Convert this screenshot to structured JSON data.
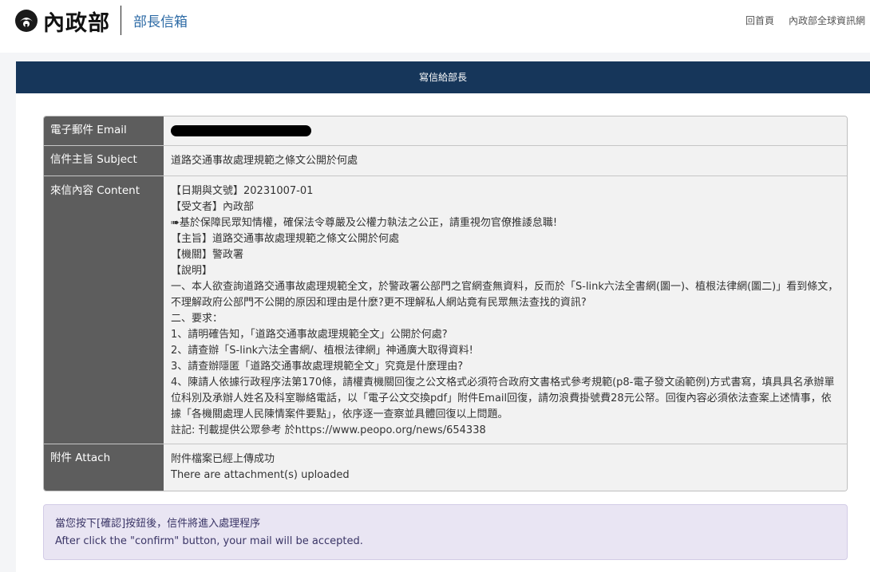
{
  "header": {
    "logo_text": "內政部",
    "site_title": "部長信箱",
    "nav": [
      "回首頁",
      "內政部全球資訊網"
    ]
  },
  "card": {
    "title": "寫信給部長"
  },
  "form": {
    "email_label": "電子郵件 Email",
    "subject_label": "信件主旨 Subject",
    "subject_value": "道路交通事故處理規範之條文公開於何處",
    "content_label": "來信內容 Content",
    "content_lines": [
      "【日期與文號】20231007-01",
      "【受文者】內政部",
      "➠基於保障民眾知情權，確保法令尊嚴及公權力執法之公正，請重視勿官僚推諉怠職!",
      "【主旨】道路交通事故處理規範之條文公開於何處",
      "【機關】警政署",
      "【說明】",
      "一、本人欲查詢道路交通事故處理規範全文，於警政署公部門之官網查無資料，反而於「S-link六法全書網(圖一)、植根法律網(圖二)」看到條文，不理解政府公部門不公開的原因和理由是什麼?更不理解私人網站竟有民眾無法查找的資訊?",
      "二、要求：",
      "1、請明確告知，「道路交通事故處理規範全文」公開於何處?",
      "2、請查辦「S-link六法全書網/、植根法律網」神通廣大取得資料!",
      "3、請查辦隱匿「道路交通事故處理規範全文」究竟是什麼理由?",
      "4、陳請人依據行政程序法第170條，請權責機關回復之公文格式必須符合政府文書格式參考規範(p8-電子發文函範例)方式書寫，填具具名承辦單位科別及承辦人姓名及科室聯絡電話，以「電子公文交換pdf」附件Email回復，請勿浪費掛號費28元公帑。回復內容必須依法查案上述情事，依據「各機關處理人民陳情案件要點」，依序逐一查察並具體回復以上問題。",
      "註記: 刊載提供公眾參考 於https://www.peopo.org/news/654338"
    ],
    "attach_label": "附件 Attach",
    "attach_lines": [
      "附件檔案已經上傳成功",
      "There are attachment(s) uploaded"
    ]
  },
  "notice": {
    "line_zh": "當您按下[確認]按鈕後，信件將進入處理程序",
    "line_en": "After click the \"confirm\" button, your mail will be accepted."
  },
  "colors": {
    "header_bar": "#16365a",
    "label_bg": "#5d5d5d",
    "value_bg": "#f2f2f2",
    "notice_bg": "#e9e5f3",
    "site_title": "#2c6aa5"
  }
}
